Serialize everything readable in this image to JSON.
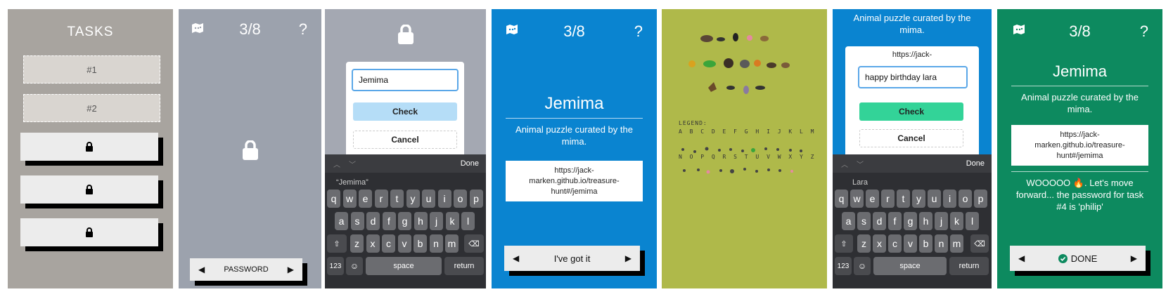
{
  "panel1": {
    "title": "TASKS",
    "tasks": [
      "#1",
      "#2"
    ],
    "locked_count": 3
  },
  "panel2": {
    "counter": "3/8",
    "help": "?",
    "bottom_button": "PASSWORD"
  },
  "panel3": {
    "input_value": "Jemima",
    "check_label": "Check",
    "cancel_label": "Cancel",
    "suggestion": "“Jemima”",
    "done_label": "Done",
    "row1": [
      "q",
      "w",
      "e",
      "r",
      "t",
      "y",
      "u",
      "i",
      "o",
      "p"
    ],
    "row2": [
      "a",
      "s",
      "d",
      "f",
      "g",
      "h",
      "j",
      "k",
      "l"
    ],
    "row3": [
      "z",
      "x",
      "c",
      "v",
      "b",
      "n",
      "m"
    ],
    "num_label": "123",
    "space_label": "space",
    "return_label": "return"
  },
  "panel4": {
    "counter": "3/8",
    "help": "?",
    "title": "Jemima",
    "description": "Animal puzzle curated by the mima.",
    "url": "https://jack-marken.github.io/treasure-hunt#/jemima",
    "bottom_button": "I've got it"
  },
  "panel5": {
    "legend_title": "LEGEND:",
    "legend_row1": "A B C D E F G H I J K L M",
    "legend_row2": "N O P Q R S T U V W X Y Z"
  },
  "panel6": {
    "description": "Animal puzzle curated by the mima.",
    "url_partial": "https://jack-",
    "input_value": "happy birthday lara",
    "check_label": "Check",
    "cancel_label": "Cancel",
    "suggestion": "Lara",
    "done_label": "Done",
    "num_label": "123",
    "space_label": "space",
    "return_label": "return"
  },
  "panel7": {
    "counter": "3/8",
    "help": "?",
    "title": "Jemima",
    "description": "Animal puzzle curated by the mima.",
    "url": "https://jack-marken.github.io/treasure-hunt#/jemima",
    "message": "WOOOOO 🔥. Let's move forward... the password for task #4 is 'philip'",
    "bottom_button": "DONE"
  },
  "colors": {
    "blue": "#0a84d0",
    "green": "#0d8a5f",
    "olive": "#afb94a",
    "check_blue": "#b5ddf7",
    "check_green": "#33d398"
  }
}
